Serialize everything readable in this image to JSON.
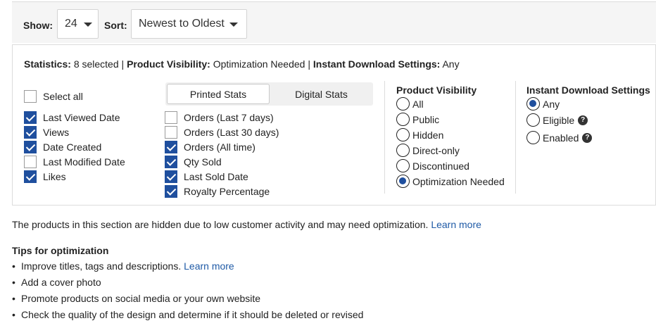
{
  "toolbar": {
    "show_label": "Show:",
    "show_value": "24",
    "sort_label": "Sort:",
    "sort_value": "Newest to Oldest"
  },
  "summary": {
    "statistics_label": "Statistics:",
    "statistics_value": "8 selected",
    "visibility_label": "Product Visibility:",
    "visibility_value": "Optimization Needed",
    "download_label": "Instant Download Settings:",
    "download_value": "Any",
    "separator": "|"
  },
  "stats": {
    "select_all": "Select all",
    "col1": [
      {
        "label": "Last Viewed Date",
        "checked": true
      },
      {
        "label": "Views",
        "checked": true
      },
      {
        "label": "Date Created",
        "checked": true
      },
      {
        "label": "Last Modified Date",
        "checked": false
      },
      {
        "label": "Likes",
        "checked": true
      }
    ],
    "tabs": [
      {
        "label": "Printed Stats",
        "active": true
      },
      {
        "label": "Digital Stats",
        "active": false
      }
    ],
    "col2": [
      {
        "label": "Orders (Last 7 days)",
        "checked": false
      },
      {
        "label": "Orders (Last 30 days)",
        "checked": false
      },
      {
        "label": "Orders (All time)",
        "checked": true
      },
      {
        "label": "Qty Sold",
        "checked": true
      },
      {
        "label": "Last Sold Date",
        "checked": true
      },
      {
        "label": "Royalty Percentage",
        "checked": true
      }
    ]
  },
  "visibility": {
    "title": "Product Visibility",
    "options": [
      {
        "label": "All",
        "selected": false
      },
      {
        "label": "Public",
        "selected": false
      },
      {
        "label": "Hidden",
        "selected": false
      },
      {
        "label": "Direct-only",
        "selected": false
      },
      {
        "label": "Discontinued",
        "selected": false
      },
      {
        "label": "Optimization Needed",
        "selected": true
      }
    ]
  },
  "download": {
    "title": "Instant Download Settings",
    "options": [
      {
        "label": "Any",
        "selected": true,
        "help": false
      },
      {
        "label": "Eligible",
        "selected": false,
        "help": true
      },
      {
        "label": "Enabled",
        "selected": false,
        "help": true
      }
    ],
    "help_glyph": "?"
  },
  "info": {
    "text": "The products in this section are hidden due to low customer activity and may need optimization.",
    "link": "Learn more"
  },
  "tips": {
    "title": "Tips for optimization",
    "bullet": "•",
    "items": [
      {
        "text": "Improve titles, tags and descriptions.",
        "link": "Learn more"
      },
      {
        "text": "Add a cover photo",
        "link": ""
      },
      {
        "text": "Promote products on social media or your own website",
        "link": ""
      },
      {
        "text": "Check the quality of the design and determine if it should be deleted or revised",
        "link": ""
      }
    ]
  },
  "colors": {
    "accent": "#1f4f9e",
    "link": "#1f5aa6",
    "toolbar_bg": "#f5f5f5"
  }
}
